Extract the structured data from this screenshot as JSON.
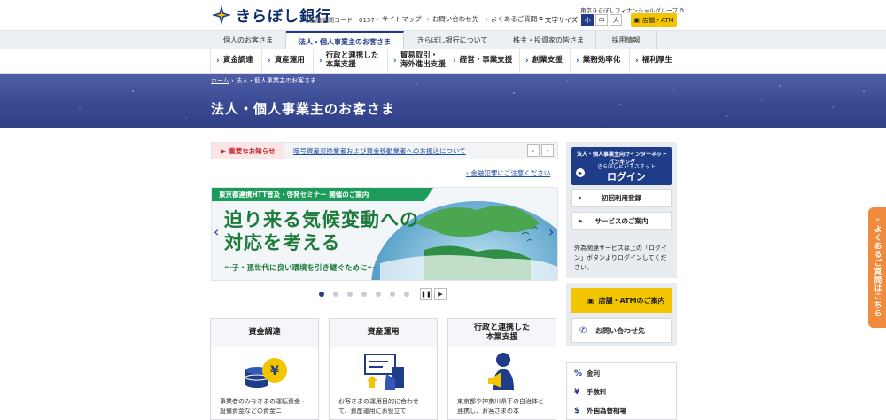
{
  "header": {
    "logo_text": "きらぼし銀行",
    "bank_code": "金融機関コード：0137",
    "group_link": "東京きらぼしフィナンシャルグループ",
    "utility_links": [
      "サイトマップ",
      "お問い合わせ先",
      "よくあるご質問"
    ],
    "font_size_label": "文字サイズ",
    "font_sizes": [
      "小",
      "中",
      "大"
    ],
    "atm_button": "店舗・ATM"
  },
  "tabs": [
    "個人のお客さま",
    "法人・個人事業主のお客さま",
    "きらぼし銀行について",
    "株主・投資家の皆さま",
    "採用情報"
  ],
  "subnav": [
    "資金調達",
    "資産運用",
    "行政と連携した 本業支援",
    "貿易取引・ 海外進出支援",
    "経営・事業支援",
    "創業支援",
    "業務効率化",
    "福利厚生"
  ],
  "breadcrumb": {
    "home": "ホーム",
    "current": "法人・個人事業主のお客さま"
  },
  "page_title": "法人・個人事業主のお客さま",
  "notice": {
    "tag": "重要なお知らせ",
    "link": "暗号資産交換業者および資金移動業者へのお振込について"
  },
  "fraud_link": "金融犯罪にご注意ください",
  "slide": {
    "tag": "東京都連携HTT普及・啓発セミナー 開催のご案内",
    "line1": "迫り来る気候変動への",
    "line2": "対応を考える",
    "sub": "〜子・孫世代に良い環境を引き継ぐために〜"
  },
  "cards": [
    {
      "title": "資金調達",
      "text": "事業者のみなさまの運転資金・設備資金などの資金ニ"
    },
    {
      "title": "資産運用",
      "text": "お客さまの運用目的に合わせて、資産運用にお役立て"
    },
    {
      "title": "行政と連携した\n本業支援",
      "text": "東京都や神奈川県下の自治体と連携し、お客さまの本"
    }
  ],
  "sidebar": {
    "login_title": "法人・個人事業主向けインターネットバンキング",
    "login_sub": "きらぼしビジネスネット",
    "login_btn": "ログイン",
    "first_reg": "初回利用登録",
    "service_guide": "サービスのご案内",
    "note": "外為関連サービスは上の「ログイン」ボタンよりログインしてください。",
    "store_link": "店舗・ATMのご案内",
    "contact_link": "お問い合わせ先",
    "quick_links": [
      {
        "icon": "%",
        "label": "金利"
      },
      {
        "icon": "¥",
        "label": "手数料"
      },
      {
        "icon": "$",
        "label": "外国為替相場"
      }
    ]
  },
  "faq_tab": "よくあるご質問はこちら",
  "colors": {
    "navy": "#1f3c88",
    "green": "#1c9b5a",
    "yellow": "#f2c500",
    "orange": "#f08a3c",
    "red": "#c0282e"
  }
}
